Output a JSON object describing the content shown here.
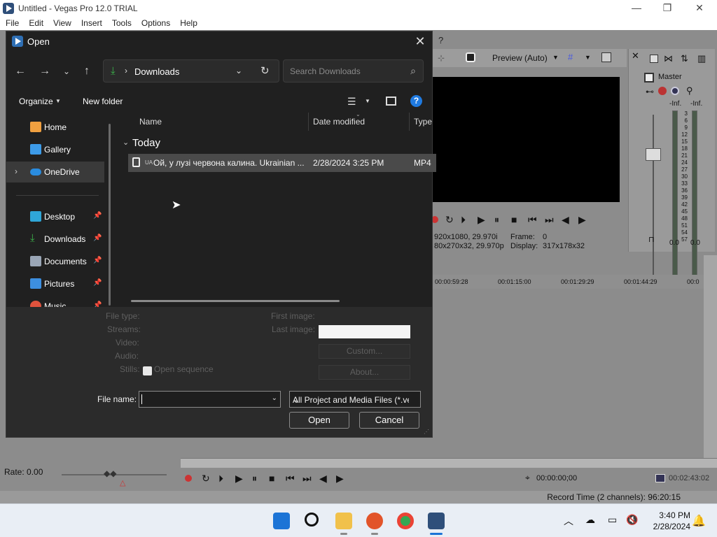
{
  "window": {
    "title": "Untitled - Vegas Pro 12.0 TRIAL",
    "minimize": "—",
    "restore": "❐",
    "close": "✕"
  },
  "menu": [
    "File",
    "Edit",
    "View",
    "Insert",
    "Tools",
    "Options",
    "Help"
  ],
  "preview": {
    "mode_label": "Preview (Auto)",
    "info_line1_left": "920x1080, 29.970i",
    "info_line1_right": "Frame:",
    "frame_value": "0",
    "info_line2_left": "80x270x32, 29.970p",
    "info_line2_right": "Display:",
    "display_value": "317x178x32"
  },
  "master": {
    "title": "Master",
    "left_inf": "-Inf.",
    "right_inf": "-Inf.",
    "left_zero": "0.0",
    "right_zero": "0.0",
    "fader_zero": "0.0",
    "scale": [
      "3",
      "6",
      "9",
      "12",
      "15",
      "18",
      "21",
      "24",
      "27",
      "30",
      "33",
      "36",
      "39",
      "42",
      "45",
      "48",
      "51",
      "54",
      "57"
    ]
  },
  "timeline": {
    "ruler": [
      "00:00:59:28",
      "00:01:15:00",
      "00:01:29:29",
      "00:01:44:29",
      "00:0"
    ],
    "rate": "Rate: 0.00",
    "timecode": "00:00:00;00",
    "length": "00:02:43:02"
  },
  "status": {
    "record_time": "Record Time (2 channels): 96:20:15"
  },
  "taskbar": {
    "time": "3:40 PM",
    "date": "2/28/2024"
  },
  "dialog": {
    "title": "Open",
    "location": "Downloads",
    "search_placeholder": "Search Downloads",
    "organize": "Organize",
    "new_folder": "New folder",
    "help": "?",
    "nav": [
      {
        "label": "Home",
        "icon": "home-icon",
        "pinned": false
      },
      {
        "label": "Gallery",
        "icon": "gallery-icon",
        "pinned": false
      },
      {
        "label": "OneDrive",
        "icon": "onedrive-icon",
        "pinned": false
      },
      {
        "label": "Desktop",
        "icon": "desktop-icon",
        "pinned": true
      },
      {
        "label": "Downloads",
        "icon": "download-icon",
        "pinned": true
      },
      {
        "label": "Documents",
        "icon": "documents-icon",
        "pinned": true
      },
      {
        "label": "Pictures",
        "icon": "pictures-icon",
        "pinned": true
      },
      {
        "label": "Music",
        "icon": "music-icon",
        "pinned": true
      }
    ],
    "columns": {
      "name": "Name",
      "date": "Date modified",
      "type": "Type"
    },
    "group": "Today",
    "file": {
      "name_prefix": "UA",
      "name": "Ой, у лузі червона калина. Ukrainian ...",
      "date": "2/28/2024 3:25 PM",
      "type": "MP4"
    },
    "info_labels": {
      "file_type": "File type:",
      "streams": "Streams:",
      "video": "Video:",
      "audio": "Audio:",
      "stills": "Stills:",
      "open_sequence": "Open sequence",
      "first_image": "First image:",
      "last_image": "Last image:"
    },
    "custom_button": "Custom...",
    "about_button": "About...",
    "file_name_label": "File name:",
    "file_name_value": "",
    "file_type_filter": "All Project and Media Files (*.ve",
    "open_button": "Open",
    "cancel_button": "Cancel"
  },
  "colors": {
    "dialog_bg": "#202020",
    "selection": "#4a4a4a",
    "vegas_gray": "#8c8c8c",
    "onedrive": "#2a8cdf",
    "help": "#1f7ae0"
  }
}
